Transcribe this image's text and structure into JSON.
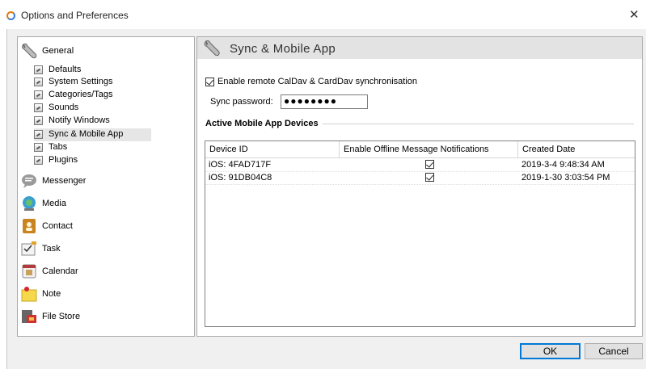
{
  "window": {
    "title": "Options and Preferences",
    "close_glyph": "✕"
  },
  "sidebar": {
    "general": {
      "label": "General",
      "icon": "wrench-icon"
    },
    "general_items": [
      {
        "label": "Defaults"
      },
      {
        "label": "System Settings"
      },
      {
        "label": "Categories/Tags"
      },
      {
        "label": "Sounds"
      },
      {
        "label": "Notify Windows"
      },
      {
        "label": "Sync & Mobile App",
        "selected": true
      },
      {
        "label": "Tabs"
      },
      {
        "label": "Plugins"
      }
    ],
    "categories": [
      {
        "label": "Messenger",
        "icon": "speech-bubble-icon"
      },
      {
        "label": "Media",
        "icon": "media-icon"
      },
      {
        "label": "Contact",
        "icon": "contact-book-icon"
      },
      {
        "label": "Task",
        "icon": "task-icon"
      },
      {
        "label": "Calendar",
        "icon": "calendar-icon"
      },
      {
        "label": "Note",
        "icon": "sticky-note-icon"
      },
      {
        "label": "File Store",
        "icon": "file-store-icon"
      }
    ]
  },
  "main": {
    "section_title": "Sync & Mobile App",
    "enable_sync": {
      "label": "Enable remote CalDav & CardDav synchronisation",
      "checked": true
    },
    "sync_password": {
      "label": "Sync password:",
      "value": "●●●●●●●●"
    },
    "devices_group_label": "Active Mobile App Devices",
    "table": {
      "columns": [
        "Device ID",
        "Enable Offline Message Notifications",
        "Created Date"
      ],
      "rows": [
        {
          "device_id": "iOS: 4FAD717F",
          "notifications": true,
          "created": "2019-3-4 9:48:34 AM"
        },
        {
          "device_id": "iOS: 91DB04C8",
          "notifications": true,
          "created": "2019-1-30 3:03:54 PM"
        }
      ]
    }
  },
  "buttons": {
    "ok": "OK",
    "cancel": "Cancel"
  },
  "colors": {
    "accent": "#0078d7",
    "section_header": "#e3e3e3",
    "selection": "#e6e6e6"
  }
}
